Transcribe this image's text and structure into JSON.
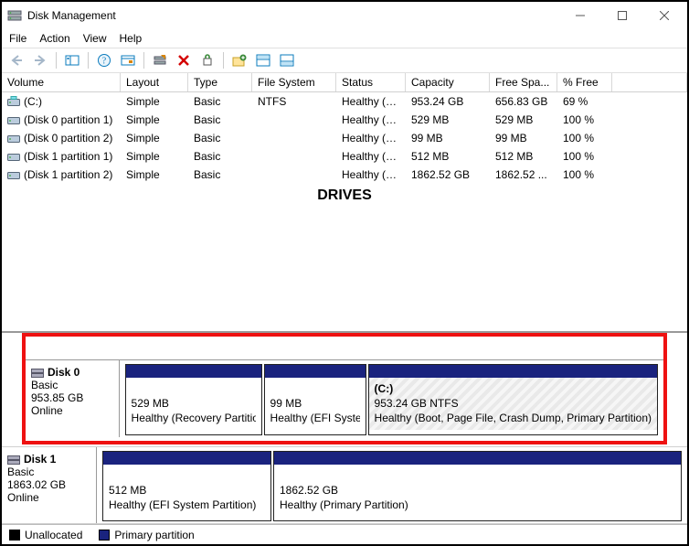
{
  "window": {
    "title": "Disk Management"
  },
  "menu": {
    "file": "File",
    "action": "Action",
    "view": "View",
    "help": "Help"
  },
  "columns": {
    "volume": "Volume",
    "layout": "Layout",
    "type": "Type",
    "fs": "File System",
    "status": "Status",
    "capacity": "Capacity",
    "free": "Free Spa...",
    "pct": "% Free"
  },
  "volumes": [
    {
      "icon": "drive",
      "name": "(C:)",
      "layout": "Simple",
      "type": "Basic",
      "fs": "NTFS",
      "status": "Healthy (B...",
      "capacity": "953.24 GB",
      "free": "656.83 GB",
      "pct": "69 %"
    },
    {
      "icon": "part",
      "name": "(Disk 0 partition 1)",
      "layout": "Simple",
      "type": "Basic",
      "fs": "",
      "status": "Healthy (R...",
      "capacity": "529 MB",
      "free": "529 MB",
      "pct": "100 %"
    },
    {
      "icon": "part",
      "name": "(Disk 0 partition 2)",
      "layout": "Simple",
      "type": "Basic",
      "fs": "",
      "status": "Healthy (E...",
      "capacity": "99 MB",
      "free": "99 MB",
      "pct": "100 %"
    },
    {
      "icon": "part",
      "name": "(Disk 1 partition 1)",
      "layout": "Simple",
      "type": "Basic",
      "fs": "",
      "status": "Healthy (E...",
      "capacity": "512 MB",
      "free": "512 MB",
      "pct": "100 %"
    },
    {
      "icon": "part",
      "name": "(Disk 1 partition 2)",
      "layout": "Simple",
      "type": "Basic",
      "fs": "",
      "status": "Healthy (P...",
      "capacity": "1862.52 GB",
      "free": "1862.52 ...",
      "pct": "100 %"
    }
  ],
  "drives_heading": "DRIVES",
  "disk0": {
    "label": "Disk 0",
    "type": "Basic",
    "size": "953.85 GB",
    "state": "Online",
    "p1": {
      "size": "529 MB",
      "status": "Healthy (Recovery Partition)"
    },
    "p2": {
      "size": "99 MB",
      "status": "Healthy (EFI System Partition)"
    },
    "p3": {
      "name": "(C:)",
      "size": "953.24 GB NTFS",
      "status": "Healthy (Boot, Page File, Crash Dump, Primary Partition)"
    }
  },
  "disk1": {
    "label": "Disk 1",
    "type": "Basic",
    "size": "1863.02 GB",
    "state": "Online",
    "p1": {
      "size": "512 MB",
      "status": "Healthy (EFI System Partition)"
    },
    "p2": {
      "size": "1862.52 GB",
      "status": "Healthy (Primary Partition)"
    }
  },
  "legend": {
    "unallocated": "Unallocated",
    "primary": "Primary partition"
  }
}
